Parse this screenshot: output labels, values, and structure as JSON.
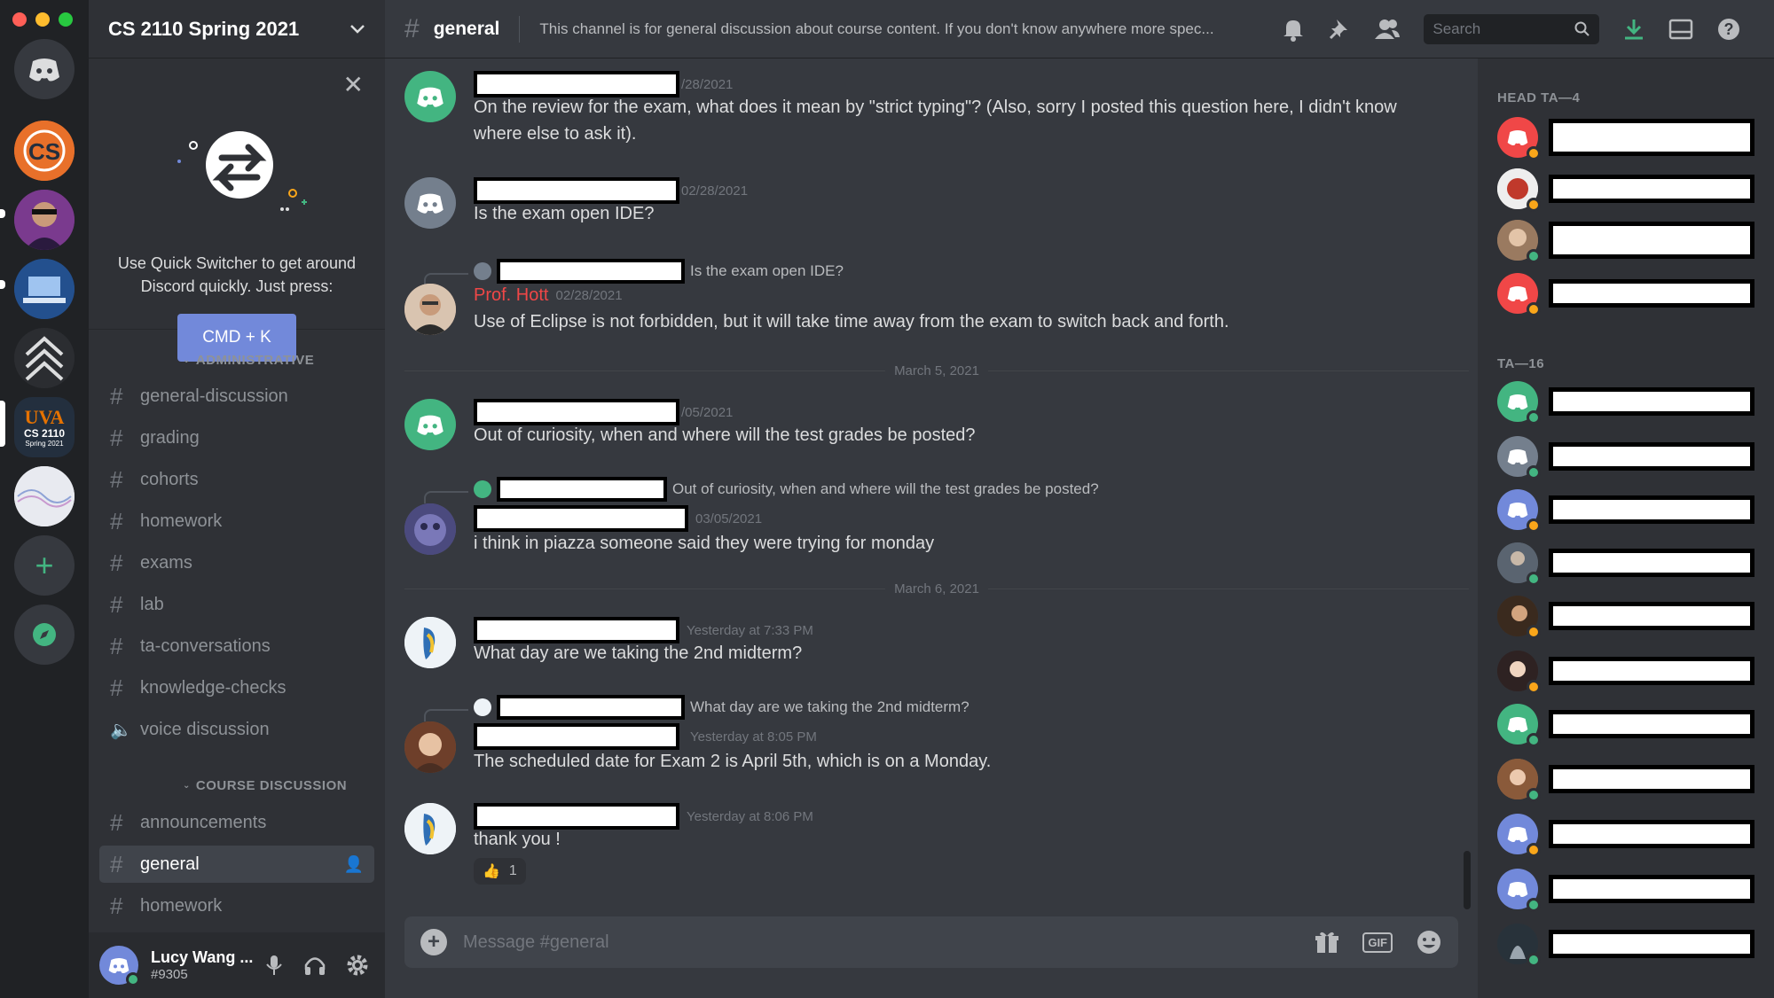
{
  "server": {
    "name": "CS 2110 Spring 2021",
    "uva_label": "UVA",
    "uva_course": "CS 2110",
    "uva_term": "Spring 2021"
  },
  "quick_switcher": {
    "text": "Use Quick Switcher to get around Discord quickly. Just press:",
    "button": "CMD + K"
  },
  "categories": [
    {
      "name": "ADMINISTRATIVE",
      "channels": [
        "general-discussion",
        "grading",
        "cohorts",
        "homework",
        "exams",
        "lab",
        "ta-conversations",
        "knowledge-checks",
        "voice discussion"
      ]
    },
    {
      "name": "COURSE DISCUSSION",
      "channels": [
        "announcements",
        "general",
        "homework"
      ]
    }
  ],
  "user": {
    "name": "Lucy Wang ...",
    "tag": "#9305"
  },
  "topbar": {
    "channel": "general",
    "topic": "This channel is for general discussion about course content. If you don't know anywhere more spec...",
    "search_placeholder": "Search"
  },
  "messages": [
    {
      "ts": "/28/2021",
      "text": "On the review for the exam, what does it mean by \"strict typing\"? (Also, sorry I posted this question here, I didn't know where else to ask it)."
    },
    {
      "ts": "02/28/2021",
      "text": "Is the exam open IDE?"
    },
    {
      "reply_text": "Is the exam open IDE?",
      "author": "Prof. Hott",
      "ts": "02/28/2021",
      "text": "Use of Eclipse is not forbidden, but it will take time away from the exam to switch back and forth."
    },
    {
      "ts": "/05/2021",
      "text": "Out of curiosity, when and where will the test grades be posted?"
    },
    {
      "reply_text": "Out of curiosity, when and where will the test grades be posted?",
      "ts": "03/05/2021",
      "text": "i think in piazza someone said they were trying for monday"
    },
    {
      "ts": "Yesterday at 7:33 PM",
      "text": "What day are we taking the 2nd midterm?"
    },
    {
      "reply_text": "What day are we taking the 2nd midterm?",
      "ts": "Yesterday at 8:05 PM",
      "text": "The scheduled date for Exam 2 is April 5th, which is on a Monday."
    },
    {
      "ts": "Yesterday at 8:06 PM",
      "text": "thank you !",
      "reaction_emoji": "👍",
      "reaction_count": "1"
    }
  ],
  "day_separators": [
    "March 5, 2021",
    "March 6, 2021"
  ],
  "composer": {
    "placeholder": "Message #general",
    "gif": "GIF"
  },
  "members": {
    "groups": [
      {
        "title": "HEAD TA—4"
      },
      {
        "title": "TA—16"
      }
    ]
  },
  "colors": {
    "accent": "#7289da",
    "online": "#43b581",
    "idle": "#faa61a",
    "author_red": "#f04747"
  }
}
